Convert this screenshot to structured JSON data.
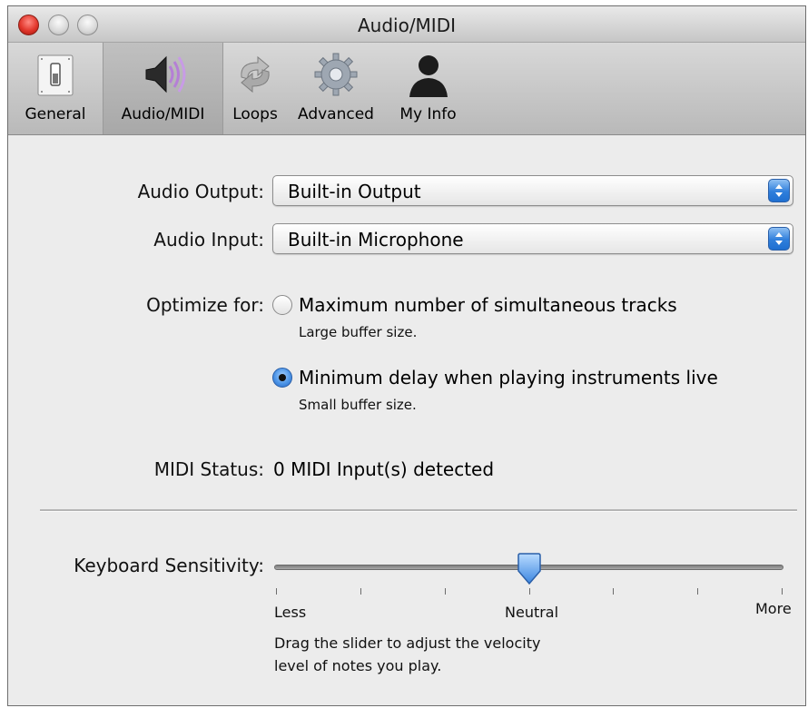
{
  "window": {
    "title": "Audio/MIDI"
  },
  "toolbar": {
    "items": [
      {
        "label": "General",
        "icon": "toggle-switch-icon"
      },
      {
        "label": "Audio/MIDI",
        "icon": "speaker-icon"
      },
      {
        "label": "Loops",
        "icon": "loop-arrows-icon"
      },
      {
        "label": "Advanced",
        "icon": "gear-icon"
      },
      {
        "label": "My Info",
        "icon": "person-silhouette-icon"
      }
    ],
    "selected": "Audio/MIDI"
  },
  "audio_output": {
    "label": "Audio Output:",
    "value": "Built-in Output"
  },
  "audio_input": {
    "label": "Audio Input:",
    "value": "Built-in Microphone"
  },
  "optimize": {
    "label": "Optimize for:",
    "options": [
      {
        "title": "Maximum number of simultaneous tracks",
        "sub": "Large buffer size.",
        "selected": false
      },
      {
        "title": "Minimum delay when playing instruments live",
        "sub": "Small buffer size.",
        "selected": true
      }
    ]
  },
  "midi": {
    "label": "MIDI Status:",
    "value": "0 MIDI Input(s) detected"
  },
  "keyboard": {
    "label": "Keyboard Sensitivity:",
    "value": 0.5,
    "less": "Less",
    "neutral": "Neutral",
    "more": "More",
    "help": [
      "Drag the slider to adjust the velocity",
      "level of notes you play."
    ]
  },
  "colors": {
    "accent": "#2f7fdc",
    "close": "#e2372c"
  }
}
